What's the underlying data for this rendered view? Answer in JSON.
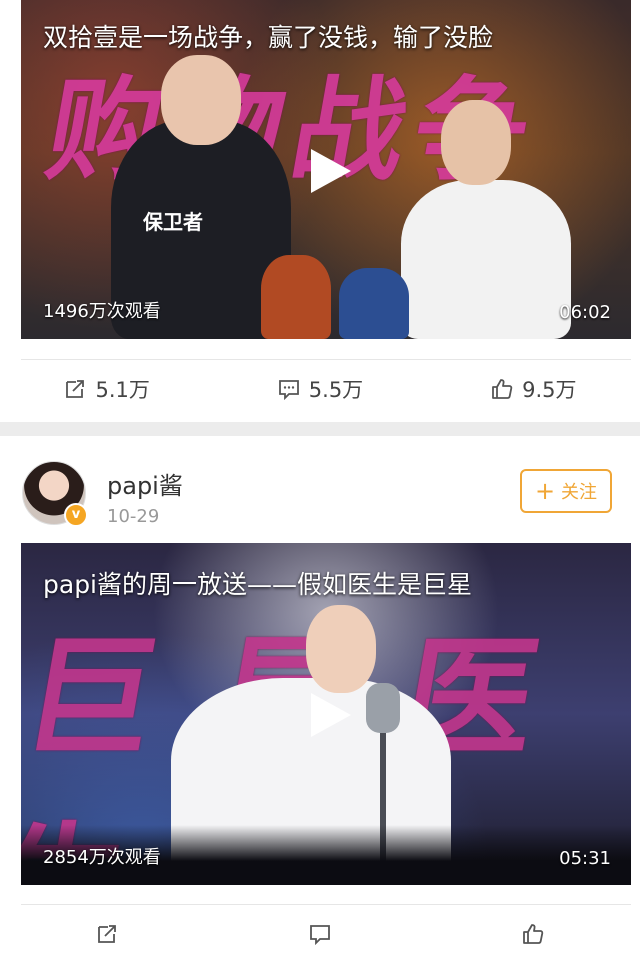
{
  "post1": {
    "video": {
      "overlay_title": "双拾壹是一场战争，赢了没钱，输了没脸",
      "big_text": "购物战争",
      "vest_text": "保卫者",
      "views": "1496万次观看",
      "duration": "06:02"
    },
    "actions": {
      "share": "5.1万",
      "comment": "5.5万",
      "like": "9.5万"
    }
  },
  "post2": {
    "author": {
      "name": "papi酱",
      "date": "10-29",
      "verified": true
    },
    "follow_label": "关注",
    "video": {
      "overlay_title": "papi酱的周一放送——假如医生是巨星",
      "big_text": "巨星医生",
      "views": "2854万次观看",
      "duration": "05:31"
    }
  },
  "icons": {
    "share": "share-icon",
    "comment": "comment-icon",
    "like": "thumbs-up-icon",
    "play": "play-icon",
    "verified": "verified-badge-icon"
  },
  "colors": {
    "accent": "#f0a636",
    "magenta_text": "#d63a9c",
    "divider": "#ececec"
  }
}
